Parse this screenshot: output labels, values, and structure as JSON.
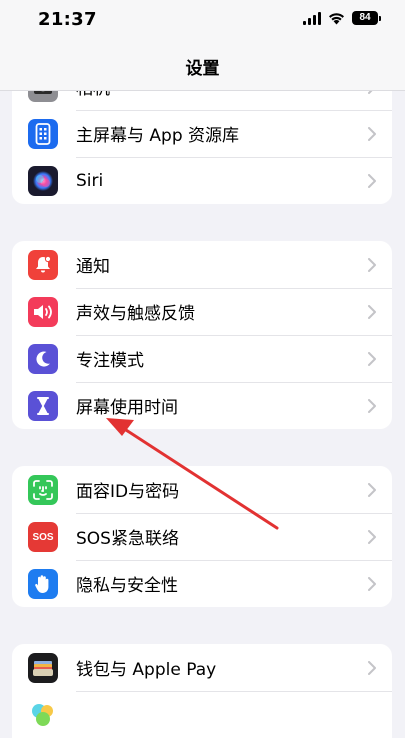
{
  "status_bar": {
    "time": "21:37",
    "battery": "84"
  },
  "nav": {
    "title": "设置"
  },
  "groups": [
    {
      "items": [
        {
          "label": "相机",
          "icon": "camera-icon",
          "color": "#8e8e93"
        },
        {
          "label": "主屏幕与 App 资源库",
          "icon": "home-screen-icon",
          "color": "#1c6bef"
        },
        {
          "label": "Siri",
          "icon": "siri-icon",
          "color": "#1a1a2e"
        }
      ]
    },
    {
      "items": [
        {
          "label": "通知",
          "icon": "notification-bell-icon",
          "color": "#f0413a"
        },
        {
          "label": "声效与触感反馈",
          "icon": "speaker-icon",
          "color": "#f33b5a"
        },
        {
          "label": "专注模式",
          "icon": "moon-icon",
          "color": "#5a51d6"
        },
        {
          "label": "屏幕使用时间",
          "icon": "hourglass-icon",
          "color": "#5a51d6"
        }
      ]
    },
    {
      "items": [
        {
          "label": "面容ID与密码",
          "icon": "face-id-icon",
          "color": "#34c759"
        },
        {
          "label": "SOS紧急联络",
          "icon": "sos-icon",
          "color": "#e53935"
        },
        {
          "label": "隐私与安全性",
          "icon": "hand-icon",
          "color": "#1e7cf0"
        }
      ]
    },
    {
      "items": [
        {
          "label": "钱包与 Apple Pay",
          "icon": "wallet-icon",
          "color": "#1c1c1e"
        }
      ]
    }
  ],
  "sos_icon_text": "SOS"
}
